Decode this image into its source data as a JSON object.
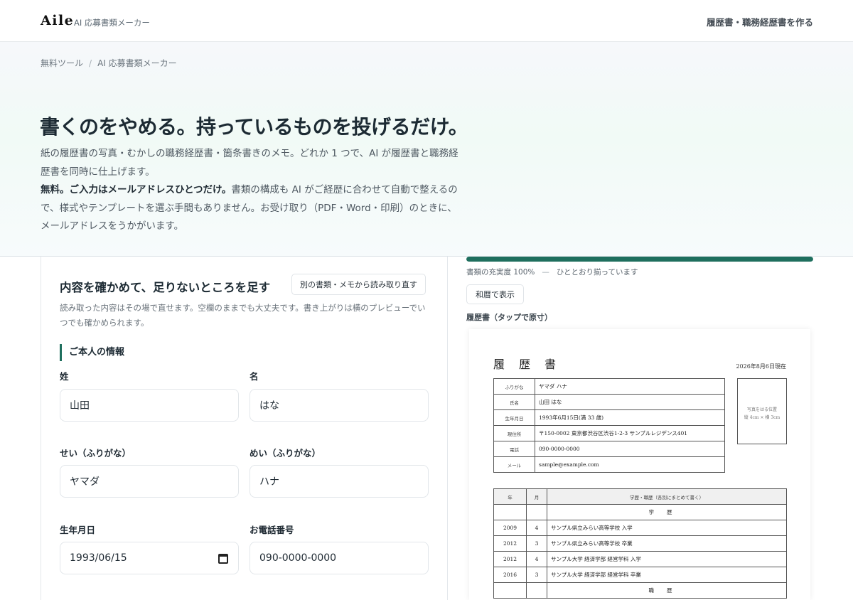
{
  "header": {
    "logo": "Aile",
    "subtitle": "AI 応募書類メーカー",
    "cta": "履歴書・職務経歴書を作る"
  },
  "breadcrumb": {
    "root": "無料ツール",
    "separator": "/",
    "current": "AI 応募書類メーカー"
  },
  "hero": {
    "title": "書くのをやめる。持っているものを投げるだけ。",
    "desc_line1": "紙の履歴書の写真・むかしの職務経歴書・箇条書きのメモ。どれか 1 つで、AI が履歴書と職務経歴書を同時に仕上げます。",
    "desc_bold": "無料。ご入力はメールアドレスひとつだけ。",
    "desc_line2": "書類の構成も AI がご経歴に合わせて自動で整えるので、様式やテンプレートを選ぶ手間もありません。お受け取り（PDF・Word・印刷）のときに、メールアドレスをうかがいます。"
  },
  "form": {
    "title": "内容を確かめて、足りないところを足す",
    "reread_button": "別の書類・メモから読み取り直す",
    "description": "読み取った内容はその場で直せます。空欄のままでも大丈夫です。書き上がりは横のプレビューでいつでも確かめられます。",
    "section": "ご本人の情報",
    "fields": {
      "last_name": {
        "label": "姓",
        "value": "山田"
      },
      "first_name": {
        "label": "名",
        "value": "はな"
      },
      "last_kana": {
        "label": "せい（ふりがな）",
        "value": "ヤマダ"
      },
      "first_kana": {
        "label": "めい（ふりがな）",
        "value": "ハナ"
      },
      "birthdate": {
        "label": "生年月日",
        "value": "1993/06/15"
      },
      "phone": {
        "label": "お電話番号",
        "value": "090-0000-0000"
      }
    }
  },
  "preview": {
    "progress_percent": 100,
    "progress_label": "書類の充実度 100%",
    "progress_dash": "—",
    "progress_status": "ひととおり揃っています",
    "wareki_button": "和暦で表示",
    "label": "履歴書（タップで原寸）",
    "resume": {
      "title": "履歴書",
      "date": "2026年8月6日現在",
      "photo_line1": "写真をはる位置",
      "photo_line2": "縦 4cm × 横 3cm",
      "rows": [
        {
          "key": "ふりがな",
          "value": "ヤマダ ハナ"
        },
        {
          "key": "氏名",
          "value": "山田 はな"
        },
        {
          "key": "生年月日",
          "value": "1993年6月15日(満 33 歳)"
        },
        {
          "key": "現住所",
          "value": "〒150-0002 東京都渋谷区渋谷1-2-3 サンプルレジデンス401"
        },
        {
          "key": "電話",
          "value": "090-0000-0000"
        },
        {
          "key": "メール",
          "value": "sample@example.com"
        }
      ],
      "history_header": {
        "year": "年",
        "month": "月",
        "content": "学歴・職歴（各別にまとめて書く）"
      },
      "education_label": "学歴",
      "work_label": "職歴",
      "education": [
        {
          "year": "2009",
          "month": "4",
          "text": "サンプル県立みらい高等学校 入学"
        },
        {
          "year": "2012",
          "month": "3",
          "text": "サンプル県立みらい高等学校 卒業"
        },
        {
          "year": "2012",
          "month": "4",
          "text": "サンプル大学 経済学部 経営学科 入学"
        },
        {
          "year": "2016",
          "month": "3",
          "text": "サンプル大学 経済学部 経営学科 卒業"
        }
      ]
    }
  }
}
